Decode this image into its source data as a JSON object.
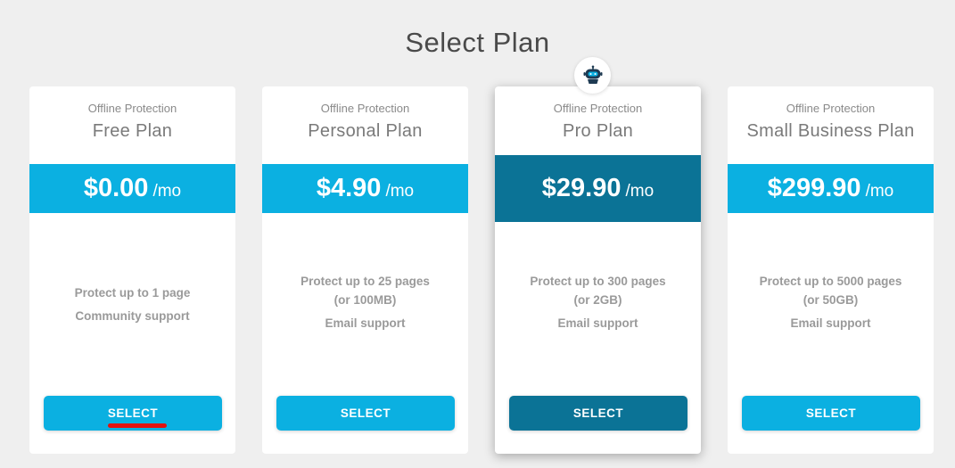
{
  "page": {
    "title": "Select Plan"
  },
  "plans": [
    {
      "subtitle": "Offline Protection",
      "name": "Free Plan",
      "price": "$0.00",
      "period": "/mo",
      "features": [
        "Protect up to 1 page",
        "Community support"
      ],
      "button_label": "SELECT"
    },
    {
      "subtitle": "Offline Protection",
      "name": "Personal Plan",
      "price": "$4.90",
      "period": "/mo",
      "features": [
        "Protect up to 25 pages",
        "(or 100MB)",
        "Email support"
      ],
      "button_label": "SELECT"
    },
    {
      "subtitle": "Offline Protection",
      "name": "Pro Plan",
      "price": "$29.90",
      "period": "/mo",
      "features": [
        "Protect up to 300 pages",
        "(or 2GB)",
        "Email support"
      ],
      "button_label": "SELECT",
      "featured": true
    },
    {
      "subtitle": "Offline Protection",
      "name": "Small Business Plan",
      "price": "$299.90",
      "period": "/mo",
      "features": [
        "Protect up to 5000 pages",
        "(or 50GB)",
        "Email support"
      ],
      "button_label": "SELECT"
    }
  ],
  "featured_badge": {
    "icon": "robot-icon"
  },
  "colors": {
    "accent": "#0bb0e1",
    "featured": "#0b7396",
    "annotation": "#e3120f"
  }
}
